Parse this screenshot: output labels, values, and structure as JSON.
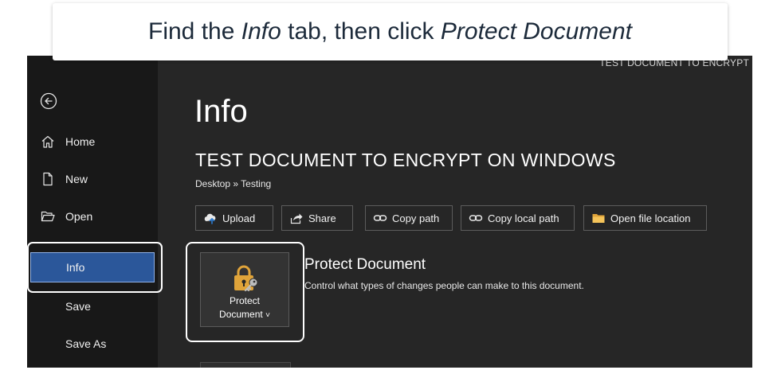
{
  "instruction": {
    "prefix": "Find the ",
    "tab_name": "Info",
    "middle": " tab, then click ",
    "button_name": "Protect Document"
  },
  "window": {
    "doc_title": "TEST DOCUMENT TO ENCRYPT"
  },
  "sidebar": {
    "back_icon": "back-arrow-icon",
    "items": [
      {
        "label": "Home",
        "icon": "home-icon"
      },
      {
        "label": "New",
        "icon": "new-document-icon"
      },
      {
        "label": "Open",
        "icon": "folder-open-icon"
      },
      {
        "label": "Info",
        "active": true
      },
      {
        "label": "Save"
      },
      {
        "label": "Save As"
      }
    ],
    "active_color": "#2b579a"
  },
  "main": {
    "title": "Info",
    "doc_name": "TEST DOCUMENT TO ENCRYPT ON WINDOWS",
    "doc_path": "Desktop » Testing",
    "actions": [
      {
        "label": "Upload",
        "icon": "cloud-upload-icon"
      },
      {
        "label": "Share",
        "icon": "share-icon"
      },
      {
        "label": "Copy path",
        "icon": "link-icon"
      },
      {
        "label": "Copy local path",
        "icon": "link-icon"
      },
      {
        "label": "Open file location",
        "icon": "folder-icon"
      }
    ],
    "protect": {
      "tile_line1": "Protect",
      "tile_line2": "Document",
      "chevron": "˅",
      "heading": "Protect Document",
      "description": "Control what types of changes people can make to this document.",
      "icon": "lock-key-icon"
    }
  }
}
